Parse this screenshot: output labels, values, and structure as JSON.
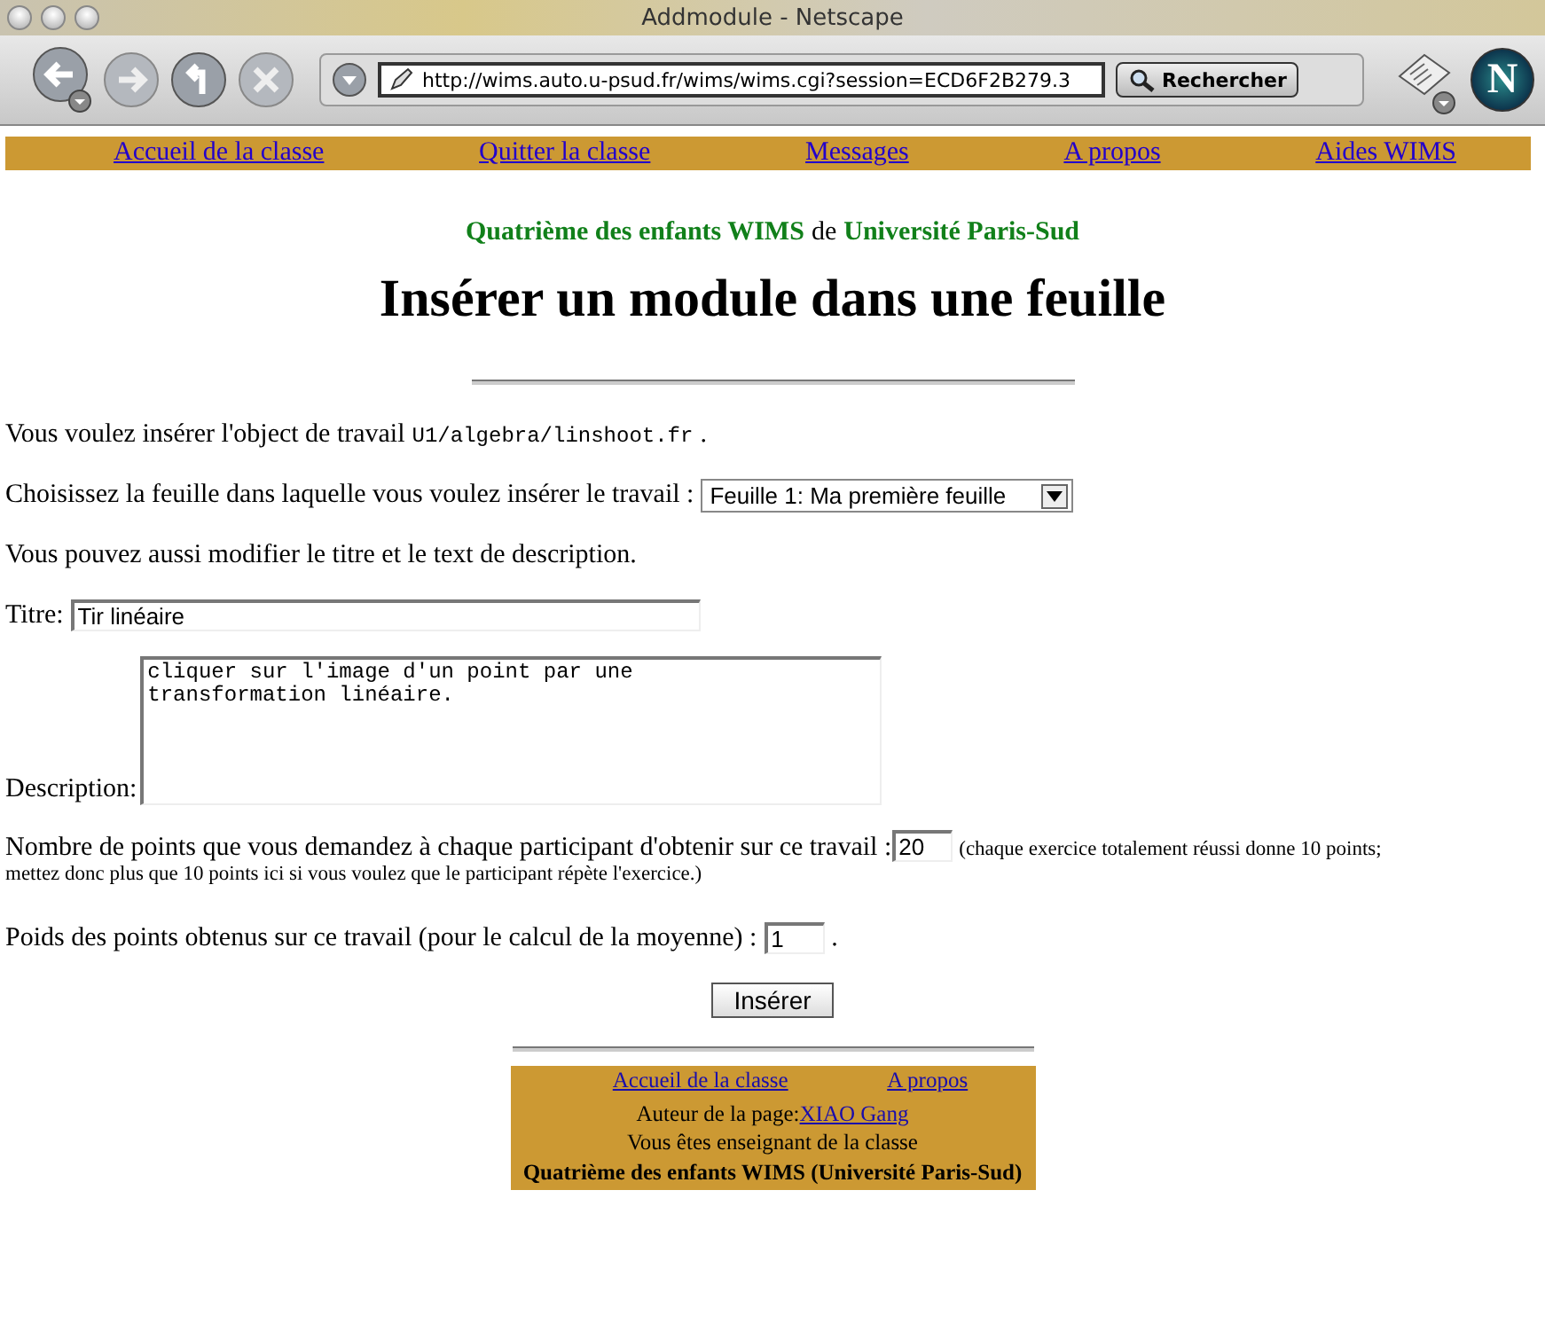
{
  "window": {
    "title": "Addmodule - Netscape"
  },
  "toolbar": {
    "url": "http://wims.auto.u-psud.fr/wims/wims.cgi?session=ECD6F2B279.3",
    "search_button": "Rechercher",
    "logo_letter": "N"
  },
  "nav_links": [
    "Accueil de la classe",
    "Quitter la classe",
    "Messages",
    "A propos",
    "Aides WIMS"
  ],
  "header": {
    "class_name": "Quatrième des enfants WIMS",
    "connector": "de",
    "institution": "Université Paris-Sud",
    "title": "Insérer un module dans une feuille"
  },
  "object_line": {
    "text": "Vous voulez insérer l'object de travail",
    "path": "U1/algebra/linshoot.fr",
    "end": "."
  },
  "sheet_choice": {
    "label": "Choisissez la feuille dans laquelle vous voulez insérer le travail :",
    "value": "Feuille 1: Ma première feuille"
  },
  "edit_note": "Vous pouvez aussi modifier le titre et le text de description.",
  "title_field": {
    "label": "Titre:",
    "value": "Tir linéaire"
  },
  "description_field": {
    "label": "Description:",
    "value": "cliquer sur l'image d'un point par une\ntransformation linéaire."
  },
  "points_field": {
    "label": "Nombre de points que vous demandez à chaque participant d'obtenir sur ce travail :",
    "value": "20",
    "note_lines": [
      "(chaque exercice totalement réussi donne 10 points;",
      "mettez donc plus que 10 points ici si vous voulez que le participant répète l'exercice.)"
    ]
  },
  "weight_field": {
    "label": "Poids des points obtenus sur ce travail (pour le calcul de la moyenne) :",
    "value": "1",
    "end": "."
  },
  "submit_button": "Insérer",
  "footer": {
    "links": [
      "Accueil de la classe",
      "A propos"
    ],
    "author_label": "Auteur de la page:",
    "author": "XIAO Gang",
    "role_line": "Vous êtes enseignant de la classe",
    "class_line": "Quatrième des enfants WIMS (Université Paris-Sud)"
  }
}
